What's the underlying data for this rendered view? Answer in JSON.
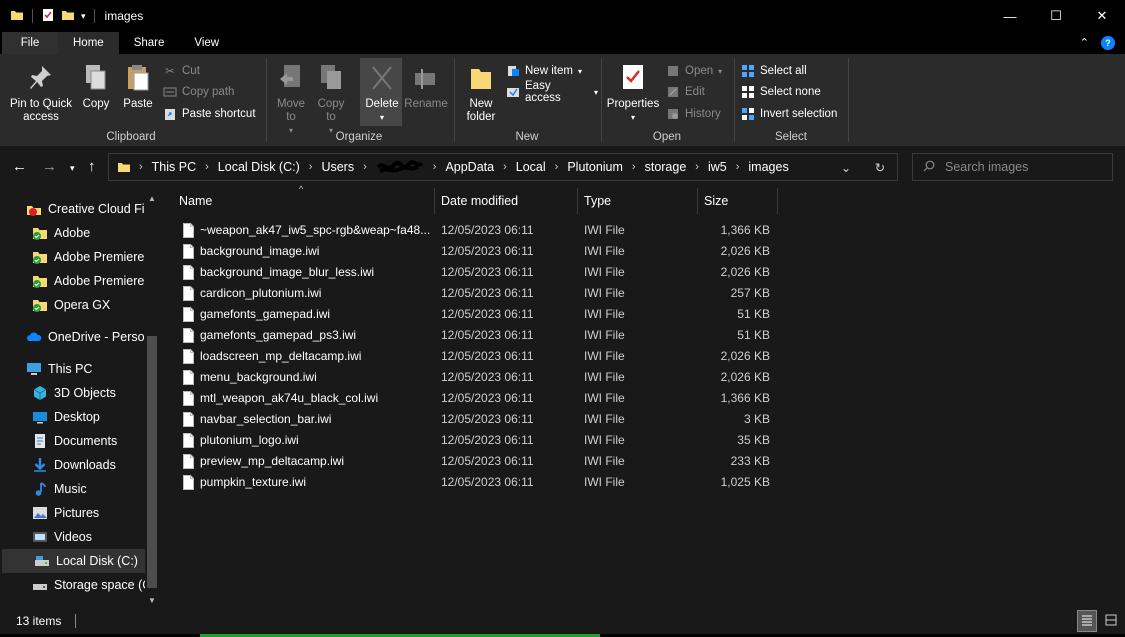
{
  "window": {
    "title": "images",
    "controls": {
      "minimize": "—",
      "maximize": "☐",
      "close": "✕"
    }
  },
  "ribbon_tabs": [
    {
      "label": "File"
    },
    {
      "label": "Home"
    },
    {
      "label": "Share"
    },
    {
      "label": "View"
    }
  ],
  "ribbon": {
    "clipboard": {
      "label": "Clipboard",
      "pin": "Pin to Quick access",
      "copy": "Copy",
      "paste": "Paste",
      "cut": "Cut",
      "copy_path": "Copy path",
      "paste_shortcut": "Paste shortcut"
    },
    "organize": {
      "label": "Organize",
      "move_to": "Move to",
      "copy_to": "Copy to",
      "delete": "Delete",
      "rename": "Rename"
    },
    "new": {
      "label": "New",
      "new_folder": "New folder",
      "new_item": "New item",
      "easy_access": "Easy access"
    },
    "open": {
      "label": "Open",
      "properties": "Properties",
      "open": "Open",
      "edit": "Edit",
      "history": "History"
    },
    "select": {
      "label": "Select",
      "select_all": "Select all",
      "select_none": "Select none",
      "invert": "Invert selection"
    }
  },
  "address": {
    "crumbs": [
      "This PC",
      "Local Disk (C:)",
      "Users",
      "",
      "AppData",
      "Local",
      "Plutonium",
      "storage",
      "iw5",
      "images"
    ]
  },
  "search": {
    "placeholder": "Search images"
  },
  "sidebar": {
    "items": [
      {
        "label": "Creative Cloud Fil",
        "icon": "creative-cloud-icon",
        "indent": 0
      },
      {
        "label": "Adobe",
        "icon": "folder-sync-icon",
        "indent": 1
      },
      {
        "label": "Adobe Premiere",
        "icon": "folder-sync-icon",
        "indent": 1
      },
      {
        "label": "Adobe Premiere",
        "icon": "folder-sync-icon",
        "indent": 1
      },
      {
        "label": "Opera GX",
        "icon": "folder-sync-icon",
        "indent": 1
      },
      {
        "label": "OneDrive - Persor",
        "icon": "onedrive-icon",
        "indent": 0
      },
      {
        "label": "This PC",
        "icon": "this-pc-icon",
        "indent": 0
      },
      {
        "label": "3D Objects",
        "icon": "3d-objects-icon",
        "indent": 1
      },
      {
        "label": "Desktop",
        "icon": "desktop-icon",
        "indent": 1
      },
      {
        "label": "Documents",
        "icon": "documents-icon",
        "indent": 1
      },
      {
        "label": "Downloads",
        "icon": "downloads-icon",
        "indent": 1
      },
      {
        "label": "Music",
        "icon": "music-icon",
        "indent": 1
      },
      {
        "label": "Pictures",
        "icon": "pictures-icon",
        "indent": 1
      },
      {
        "label": "Videos",
        "icon": "videos-icon",
        "indent": 1
      },
      {
        "label": "Local Disk (C:)",
        "icon": "local-disk-icon",
        "indent": 1,
        "selected": true
      },
      {
        "label": "Storage space (C",
        "icon": "storage-drive-icon",
        "indent": 1
      }
    ]
  },
  "columns": {
    "name": "Name",
    "date": "Date modified",
    "type": "Type",
    "size": "Size"
  },
  "files": [
    {
      "name": "~weapon_ak47_iw5_spc-rgb&weap~fa48...",
      "date": "12/05/2023 06:11",
      "type": "IWI File",
      "size": "1,366 KB"
    },
    {
      "name": "background_image.iwi",
      "date": "12/05/2023 06:11",
      "type": "IWI File",
      "size": "2,026 KB"
    },
    {
      "name": "background_image_blur_less.iwi",
      "date": "12/05/2023 06:11",
      "type": "IWI File",
      "size": "2,026 KB"
    },
    {
      "name": "cardicon_plutonium.iwi",
      "date": "12/05/2023 06:11",
      "type": "IWI File",
      "size": "257 KB"
    },
    {
      "name": "gamefonts_gamepad.iwi",
      "date": "12/05/2023 06:11",
      "type": "IWI File",
      "size": "51 KB"
    },
    {
      "name": "gamefonts_gamepad_ps3.iwi",
      "date": "12/05/2023 06:11",
      "type": "IWI File",
      "size": "51 KB"
    },
    {
      "name": "loadscreen_mp_deltacamp.iwi",
      "date": "12/05/2023 06:11",
      "type": "IWI File",
      "size": "2,026 KB"
    },
    {
      "name": "menu_background.iwi",
      "date": "12/05/2023 06:11",
      "type": "IWI File",
      "size": "2,026 KB"
    },
    {
      "name": "mtl_weapon_ak74u_black_col.iwi",
      "date": "12/05/2023 06:11",
      "type": "IWI File",
      "size": "1,366 KB"
    },
    {
      "name": "navbar_selection_bar.iwi",
      "date": "12/05/2023 06:11",
      "type": "IWI File",
      "size": "3 KB"
    },
    {
      "name": "plutonium_logo.iwi",
      "date": "12/05/2023 06:11",
      "type": "IWI File",
      "size": "35 KB"
    },
    {
      "name": "preview_mp_deltacamp.iwi",
      "date": "12/05/2023 06:11",
      "type": "IWI File",
      "size": "233 KB"
    },
    {
      "name": "pumpkin_texture.iwi",
      "date": "12/05/2023 06:11",
      "type": "IWI File",
      "size": "1,025 KB"
    }
  ],
  "status": {
    "item_count": "13 items"
  },
  "colors": {
    "bg": "#191919",
    "ribbon": "#2b2b2b",
    "titlebar": "#000000",
    "folder": "#f8d775",
    "accent_blue": "#0a84ff"
  }
}
